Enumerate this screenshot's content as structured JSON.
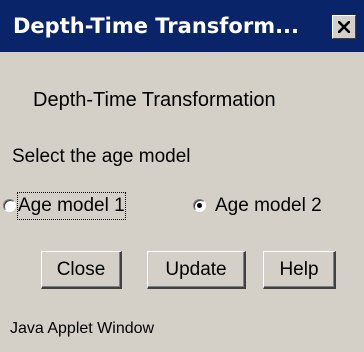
{
  "window": {
    "title": "Depth-Time Transform...",
    "close_icon": "close-icon"
  },
  "main": {
    "heading": "Depth-Time Transformation",
    "prompt": "Select the age model",
    "age_models": [
      {
        "label": "Age model 1",
        "selected": false,
        "focused": true
      },
      {
        "label": "Age model 2",
        "selected": true,
        "focused": false
      }
    ]
  },
  "buttons": {
    "close_label": "Close",
    "update_label": "Update",
    "help_label": "Help"
  },
  "status": {
    "text": "Java Applet Window"
  },
  "colors": {
    "titlebar": "#0a246a",
    "window_bg": "#d4d0c8"
  }
}
